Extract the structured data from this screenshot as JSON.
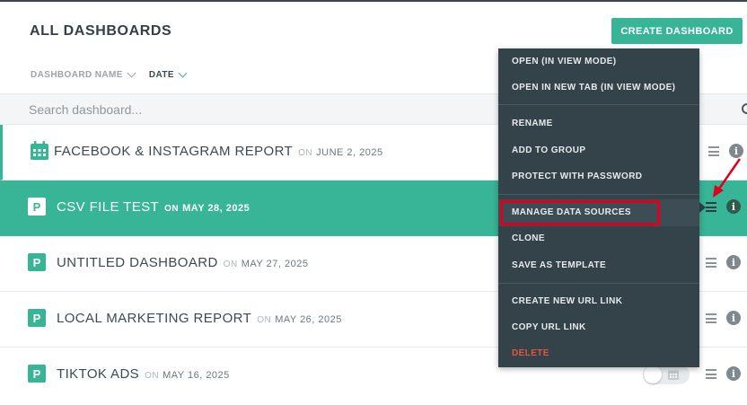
{
  "page": {
    "title": "ALL DASHBOARDS"
  },
  "toolbar": {
    "create_label": "CREATE DASHBOARD"
  },
  "sort": [
    {
      "label": "DASHBOARD NAME",
      "active": false
    },
    {
      "label": "DATE",
      "active": true
    }
  ],
  "search": {
    "placeholder": "Search dashboard...",
    "value": ""
  },
  "on_label": "ON",
  "rows": [
    {
      "title": "FACEBOOK & INSTAGRAM REPORT",
      "date": "JUNE 2, 2025",
      "icon": "calendar-icon"
    },
    {
      "title": "CSV FILE TEST",
      "date": "MAY 28, 2025",
      "icon": "p",
      "selected": true
    },
    {
      "title": "UNTITLED DASHBOARD",
      "date": "MAY 27, 2025",
      "icon": "p"
    },
    {
      "title": "LOCAL MARKETING REPORT",
      "date": "MAY 26, 2025",
      "icon": "p"
    },
    {
      "title": "TIKTOK ADS",
      "date": "MAY 16, 2025",
      "icon": "p"
    }
  ],
  "row_icon_letter": "P",
  "info_glyph": "i",
  "menu": {
    "items": [
      {
        "label": "OPEN (IN VIEW MODE)"
      },
      {
        "label": "OPEN IN NEW TAB (IN VIEW MODE)"
      },
      {
        "label": "RENAME"
      },
      {
        "label": "ADD TO GROUP"
      },
      {
        "label": "PROTECT WITH PASSWORD"
      },
      {
        "label": "MANAGE DATA SOURCES",
        "highlighted": true
      },
      {
        "label": "CLONE"
      },
      {
        "label": "SAVE AS TEMPLATE"
      },
      {
        "label": "CREATE NEW URL LINK"
      },
      {
        "label": "COPY URL LINK"
      },
      {
        "label": "DELETE",
        "danger": true
      }
    ]
  },
  "colors": {
    "accent": "#37b596",
    "menu_bg": "#344249",
    "danger": "#e2563f",
    "annotation": "#e0001b"
  }
}
